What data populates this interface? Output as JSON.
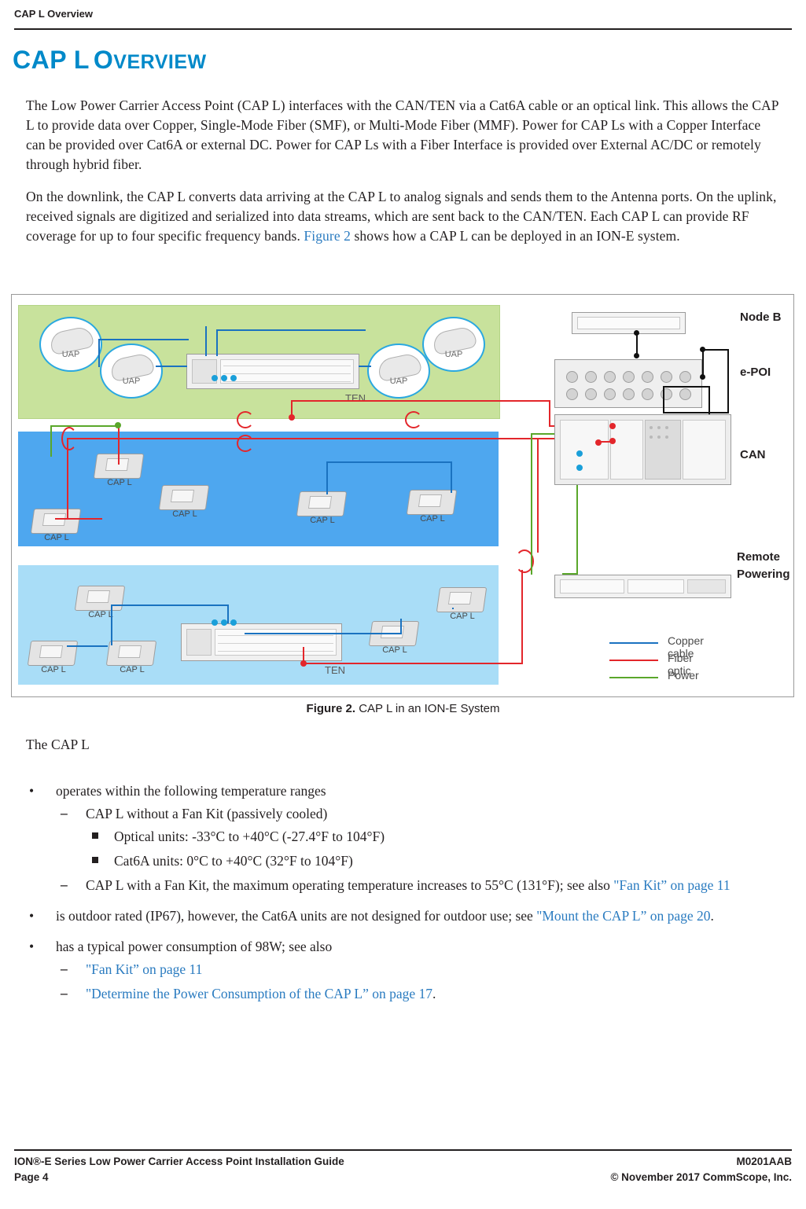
{
  "header": {
    "running_head": "CAP L Overview"
  },
  "title": {
    "big1": "CAP L",
    "rest_first": "O",
    "rest_small": "VERVIEW",
    "accent": "#0089c9"
  },
  "body": {
    "p1": "The Low Power Carrier Access Point (CAP L) interfaces with the CAN/TEN via a Cat6A cable or an optical link. This allows the CAP L to provide data over Copper, Single-Mode Fiber (SMF), or Multi-Mode Fiber (MMF). Power for CAP Ls with a Copper Interface can be provided over Cat6A or external DC. Power for CAP Ls with a Fiber Interface is provided over External AC/DC or remotely through hybrid fiber.",
    "p2_a": "On the downlink, the CAP L converts data arriving at the CAP L to analog signals and sends them to the Antenna ports. On the uplink, received signals are digitized and serialized into data streams, which are sent back to the CAN/TEN. Each CAP L can provide RF coverage for up to four specific frequency bands. ",
    "p2_link": "Figure 2",
    "p2_b": " shows how a CAP L can be deployed in an ION-E system.",
    "p3": "The CAP L"
  },
  "figure": {
    "caption_label": "Figure 2.",
    "caption_text": "CAP L in an ION-E System",
    "uap_label": "UAP",
    "capl_label": "CAP L",
    "ten_label": "TEN",
    "labels": {
      "node_b": "Node B",
      "epoi_a": "e-PO",
      "epoi_b": "I",
      "can": "CAN",
      "remote": "Remote",
      "powering": "Powering"
    },
    "legend": [
      {
        "text": "Copper cable",
        "color": "#1a72c0"
      },
      {
        "text": "Fiber optic",
        "color": "#e3262b"
      },
      {
        "text": "Power",
        "color": "#5aa72b"
      }
    ]
  },
  "bullets": {
    "b1": "operates within the following temperature ranges",
    "b1_s1": "CAP L without a Fan Kit (passively cooled)",
    "b1_s1_i1": "Optical units: -33°C to +40°C (-27.4°F to 104°F)",
    "b1_s1_i2": "Cat6A units: 0°C to +40°C (32°F to 104°F)",
    "b1_s2_a": "CAP L with a Fan Kit, the maximum operating temperature increases to 55°C (131°F); see also ",
    "b1_s2_link": "\"Fan Kit” on page 11",
    "b2_a": "is outdoor rated (IP67), however, the Cat6A units are not designed for outdoor use; see ",
    "b2_link": "\"Mount the CAP L” on page 20",
    "b2_b": ".",
    "b3": "has a typical power consumption of 98W; see also",
    "b3_s1_link": "\"Fan Kit” on page 11",
    "b3_s2_link": "\"Determine the Power Consumption of the CAP L” on page 17",
    "b3_s2_b": "."
  },
  "footer": {
    "left1": "ION®-E Series Low Power Carrier Access Point Installation Guide",
    "left2": "Page 4",
    "right1": "M0201AAB",
    "right2": "© November 2017 CommScope, Inc."
  }
}
